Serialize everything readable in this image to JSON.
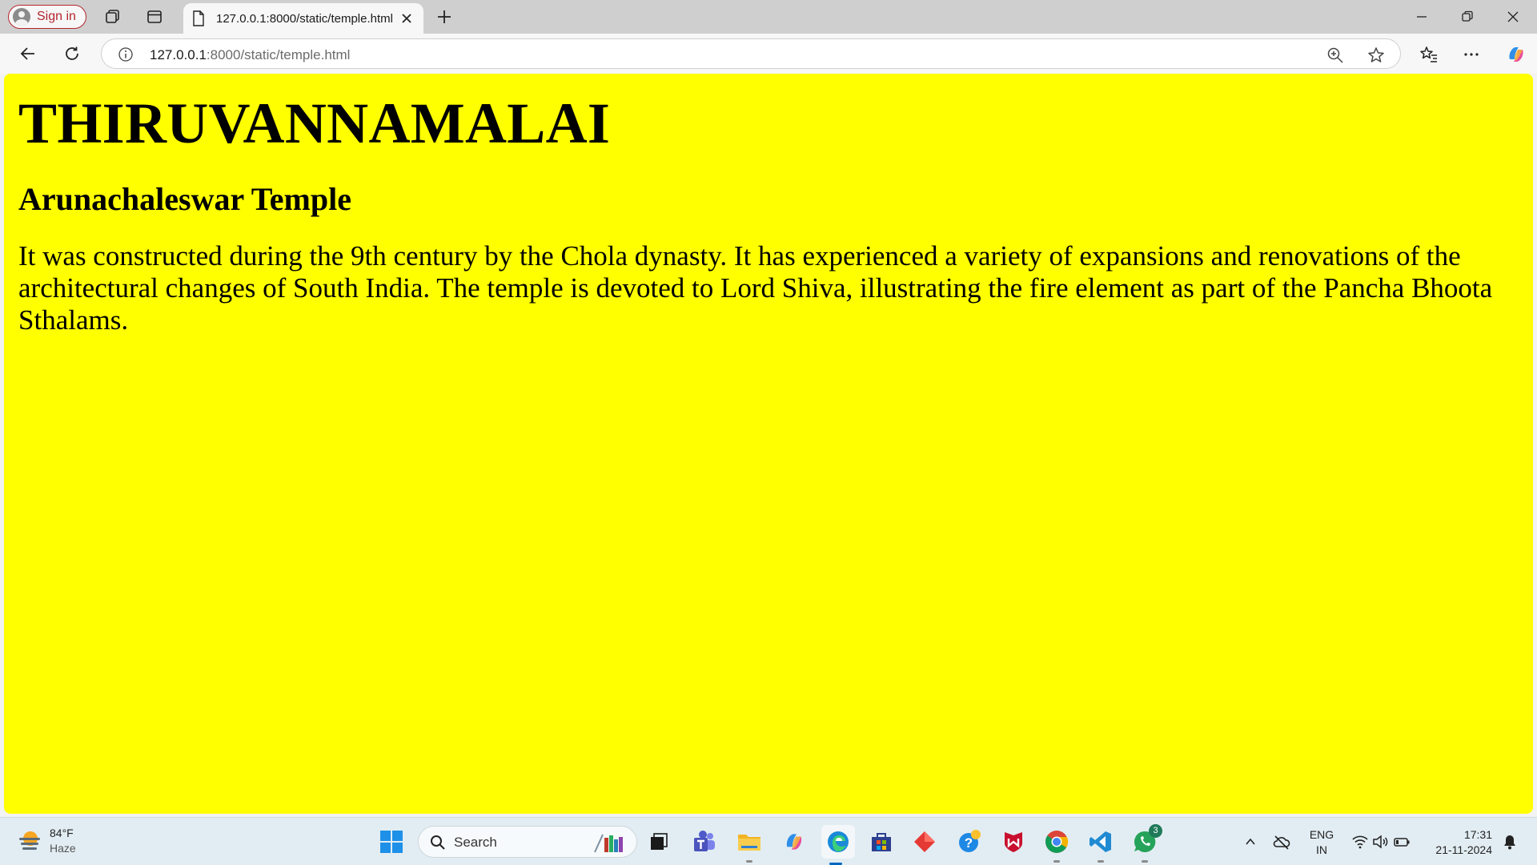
{
  "browser": {
    "sign_in_label": "Sign in",
    "tab": {
      "title": "127.0.0.1:8000/static/temple.html"
    },
    "address": {
      "host": "127.0.0.1",
      "path": ":8000/static/temple.html"
    }
  },
  "page": {
    "heading": "THIRUVANNAMALAI",
    "subheading": "Arunachaleswar Temple",
    "paragraph": "It was constructed during the 9th century by the Chola dynasty. It has experienced a variety of expansions and renovations of the architectural changes of South India. The temple is devoted to Lord Shiva, illustrating the fire element as part of the Pancha Bhoota Sthalams.",
    "background_color": "#ffff00"
  },
  "taskbar": {
    "weather": {
      "temperature": "84°F",
      "condition": "Haze"
    },
    "search_label": "Search",
    "whatsapp_badge": "3",
    "language": {
      "line1": "ENG",
      "line2": "IN"
    },
    "clock": {
      "time": "17:31",
      "date": "21-11-2024"
    }
  }
}
